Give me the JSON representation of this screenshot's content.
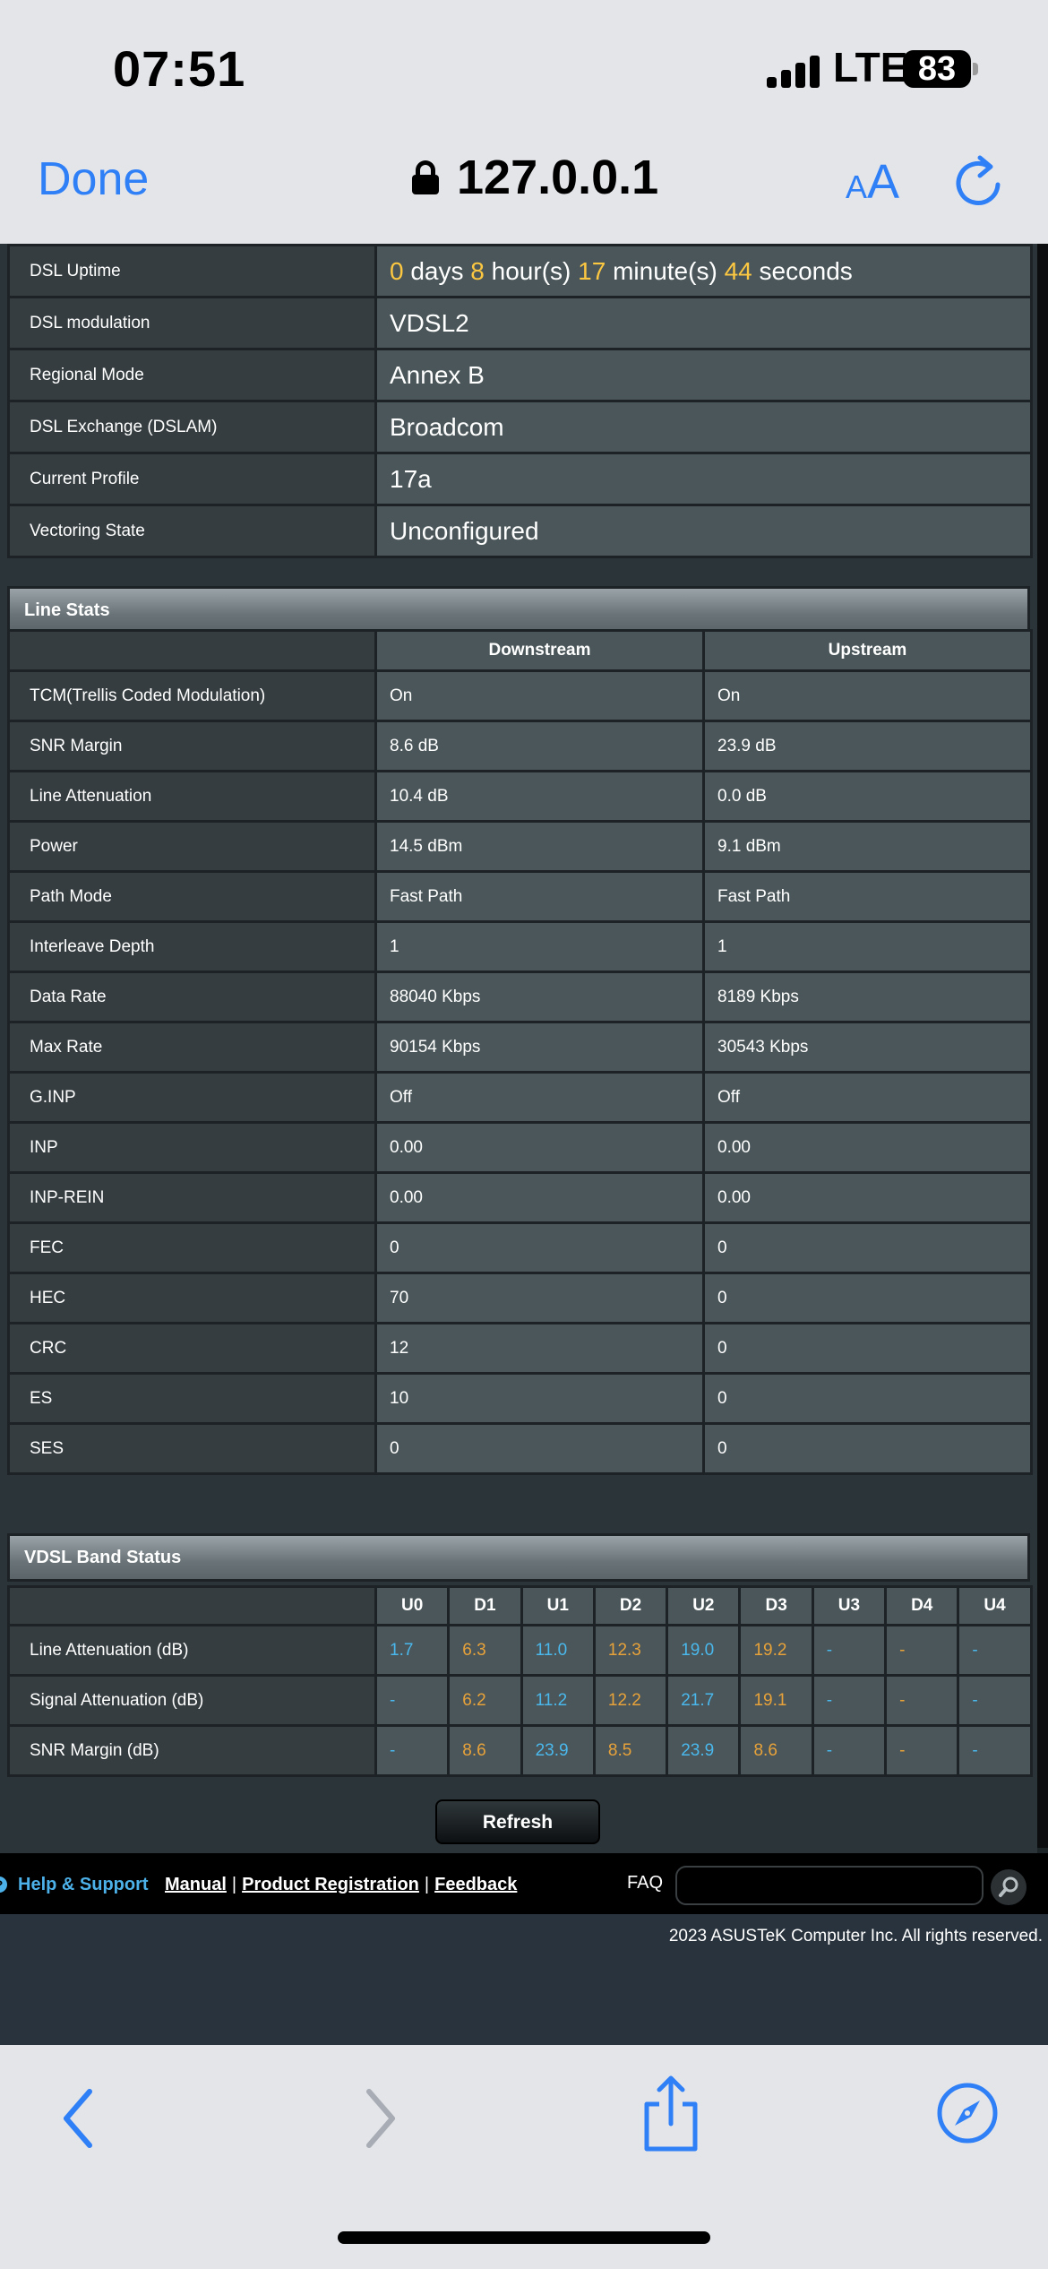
{
  "status_bar": {
    "time": "07:51",
    "network": "LTE",
    "battery": "83"
  },
  "browser": {
    "done_label": "Done",
    "url": "127.0.0.1",
    "text_size_small": "A",
    "text_size_large": "A"
  },
  "uptime": {
    "rows": [
      {
        "label": "DSL Uptime"
      },
      {
        "label": "DSL modulation",
        "value": "VDSL2"
      },
      {
        "label": "Regional Mode",
        "value": "Annex B"
      },
      {
        "label": "DSL Exchange (DSLAM)",
        "value": "Broadcom"
      },
      {
        "label": "Current Profile",
        "value": "17a"
      },
      {
        "label": "Vectoring State",
        "value": "Unconfigured"
      }
    ],
    "days": "0",
    "days_unit": "days",
    "hours": "8",
    "hours_unit": "hour(s)",
    "minutes": "17",
    "minutes_unit": "minute(s)",
    "seconds": "44",
    "seconds_unit": "seconds"
  },
  "line_stats": {
    "title": "Line Stats",
    "columns": [
      "Downstream",
      "Upstream"
    ],
    "rows": [
      {
        "label": "TCM(Trellis Coded Modulation)",
        "down": "On",
        "up": "On"
      },
      {
        "label": "SNR Margin",
        "down": "8.6 dB",
        "up": "23.9 dB"
      },
      {
        "label": "Line Attenuation",
        "down": "10.4 dB",
        "up": "0.0 dB"
      },
      {
        "label": "Power",
        "down": "14.5 dBm",
        "up": "9.1 dBm"
      },
      {
        "label": "Path Mode",
        "down": "Fast Path",
        "up": "Fast Path"
      },
      {
        "label": "Interleave Depth",
        "down": "1",
        "up": "1"
      },
      {
        "label": "Data Rate",
        "down": "88040 Kbps",
        "up": "8189 Kbps"
      },
      {
        "label": "Max Rate",
        "down": "90154 Kbps",
        "up": "30543 Kbps"
      },
      {
        "label": "G.INP",
        "down": "Off",
        "up": "Off"
      },
      {
        "label": "INP",
        "down": "0.00",
        "up": "0.00"
      },
      {
        "label": "INP-REIN",
        "down": "0.00",
        "up": "0.00"
      },
      {
        "label": "FEC",
        "down": "0",
        "up": "0"
      },
      {
        "label": "HEC",
        "down": "70",
        "up": "0"
      },
      {
        "label": "CRC",
        "down": "12",
        "up": "0"
      },
      {
        "label": "ES",
        "down": "10",
        "up": "0"
      },
      {
        "label": "SES",
        "down": "0",
        "up": "0"
      }
    ]
  },
  "band_status": {
    "title": "VDSL Band Status",
    "bands": [
      "U0",
      "D1",
      "U1",
      "D2",
      "U2",
      "D3",
      "U3",
      "D4",
      "U4"
    ],
    "upstream_color": "#4ab8ec",
    "downstream_color": "#e8a23a",
    "rows": [
      {
        "label": "Line Attenuation (dB)",
        "values": [
          "1.7",
          "6.3",
          "11.0",
          "12.3",
          "19.0",
          "19.2",
          "-",
          "-",
          "-"
        ]
      },
      {
        "label": "Signal Attenuation (dB)",
        "values": [
          "-",
          "6.2",
          "11.2",
          "12.2",
          "21.7",
          "19.1",
          "-",
          "-",
          "-"
        ]
      },
      {
        "label": "SNR Margin (dB)",
        "values": [
          "-",
          "8.6",
          "23.9",
          "8.5",
          "23.9",
          "8.6",
          "-",
          "-",
          "-"
        ]
      }
    ]
  },
  "refresh_label": "Refresh",
  "footer": {
    "help_label": "Help & Support",
    "links": [
      "Manual",
      "Product Registration",
      "Feedback"
    ],
    "faq_label": "FAQ",
    "faq_value": "",
    "copyright": "2023 ASUSTeK Computer Inc. All rights reserved."
  },
  "icons": {
    "lock": "lock-icon",
    "reload": "reload-icon",
    "back": "chevron-left-icon",
    "forward": "chevron-right-icon",
    "share": "share-icon",
    "compass": "compass-icon",
    "search": "search-icon",
    "help": "question-icon"
  },
  "colors": {
    "accent": "#2f7ff7",
    "highlight": "#fcc741",
    "link": "#4db1e9"
  }
}
